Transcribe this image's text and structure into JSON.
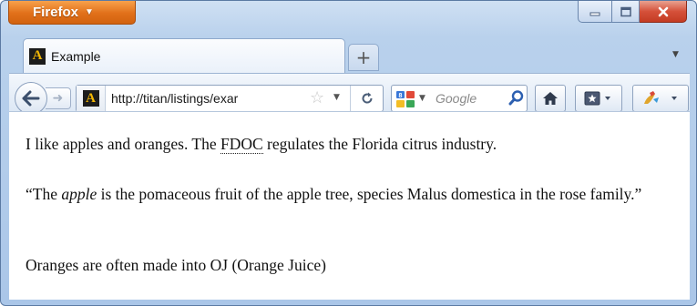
{
  "titlebar": {
    "app_button_label": "Firefox",
    "controls": [
      "minimize",
      "maximize",
      "close"
    ]
  },
  "tab": {
    "favicon_letter": "A",
    "title": "Example"
  },
  "navbar": {
    "url": "http://titan/listings/exar",
    "search_placeholder": "Google"
  },
  "content": {
    "para1_before": "I like apples and oranges. The ",
    "para1_abbr": "FDOC",
    "para1_after": " regulates the Florida citrus industry.",
    "quote_open": "“The ",
    "quote_em": "apple",
    "quote_rest": " is the pomaceous fruit of the apple tree, species Malus domestica in the rose family.”",
    "para3": "Oranges are often made into OJ (Orange Juice)"
  },
  "colors": {
    "firefox_orange": "#e1701a",
    "frame_blue": "#b9d1ec",
    "close_red": "#c43b23"
  },
  "icons": [
    "firefox-menu-caret-icon",
    "minimize-icon",
    "maximize-icon",
    "close-icon",
    "favicon-icon",
    "new-tab-icon",
    "tab-list-icon",
    "back-arrow-icon",
    "forward-arrow-icon",
    "star-icon",
    "reload-icon",
    "search-engine-icon",
    "magnifier-icon",
    "home-icon",
    "bookmarks-icon",
    "addon-icon"
  ]
}
